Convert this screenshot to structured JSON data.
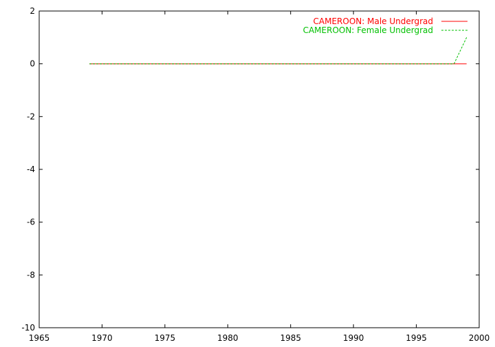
{
  "chart_data": {
    "type": "line",
    "title": "",
    "xlabel": "",
    "ylabel": "",
    "xlim": [
      1965,
      2000
    ],
    "ylim": [
      -10,
      2
    ],
    "x_ticks": [
      1965,
      1970,
      1975,
      1980,
      1985,
      1990,
      1995,
      2000
    ],
    "y_ticks": [
      -10,
      -8,
      -6,
      -4,
      -2,
      0,
      2
    ],
    "grid": false,
    "legend_position": "top-right",
    "series": [
      {
        "name": "CAMEROON: Male Undergrad",
        "color": "#ff0000",
        "dash": "solid",
        "x": [
          1969,
          1998,
          1999
        ],
        "y": [
          0,
          0,
          0
        ]
      },
      {
        "name": "CAMEROON: Female Undergrad",
        "color": "#00c000",
        "dash": "dashed",
        "x": [
          1969,
          1998,
          1999
        ],
        "y": [
          0,
          0,
          1
        ]
      }
    ]
  }
}
